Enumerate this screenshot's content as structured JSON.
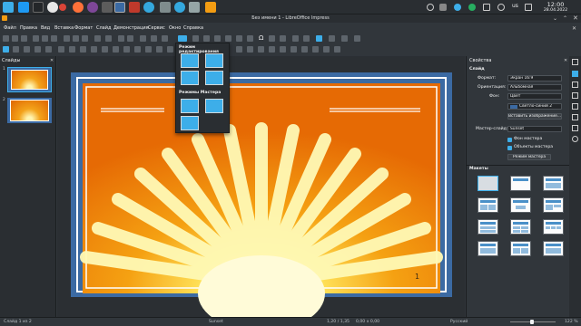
{
  "taskbar": {
    "clock_time": "12:00",
    "clock_date": "28.04.2022",
    "language": "us",
    "app_icons": [
      "start-menu-icon",
      "file-manager-icon",
      "terminal-icon",
      "chrome-icon",
      "firefox-icon",
      "tor-icon",
      "app-icon",
      "workspace-icon",
      "app-icon",
      "red-app-icon",
      "telegram-icon",
      "app-icon",
      "telegram-icon",
      "app-icon",
      "libreoffice-icon"
    ]
  },
  "window": {
    "title": "Без имени 1 - LibreOffice Impress"
  },
  "menu": [
    "Файл",
    "Правка",
    "Вид",
    "Вставка",
    "Формат",
    "Слайд",
    "Демонстрация",
    "Сервис",
    "Окно",
    "Справка"
  ],
  "slides_panel": {
    "title": "Слайды"
  },
  "popup": {
    "edit_modes_title": "Режим редактирования",
    "master_modes_title": "Режимы Мастера"
  },
  "slide": {
    "page_number": "1"
  },
  "properties": {
    "title": "Свойства",
    "slide_section": "Слайд",
    "format_label": "Формат:",
    "format_value": "Экран 16:9",
    "orientation_label": "Ориентация:",
    "orientation_value": "Альбомная",
    "background_label": "Фон:",
    "background_value": "Цвет",
    "color_value": "Светло-синий 2",
    "insert_image_label": "Вставить изображение...",
    "master_label": "Мастер-слайд:",
    "master_value": "Sunset",
    "master_bg_label": "Фон мастера",
    "master_objects_label": "Объекты мастера",
    "master_mode_button": "Режим мастера",
    "layouts_section": "Макеты",
    "accent_color": "#3daee9"
  },
  "status": {
    "slide_info": "Слайд 1 из 2",
    "master_name": "Sunset",
    "position": "1,20 / 1,35",
    "size": "0,00 x 0,00",
    "language": "Русский",
    "zoom": "122 %"
  }
}
